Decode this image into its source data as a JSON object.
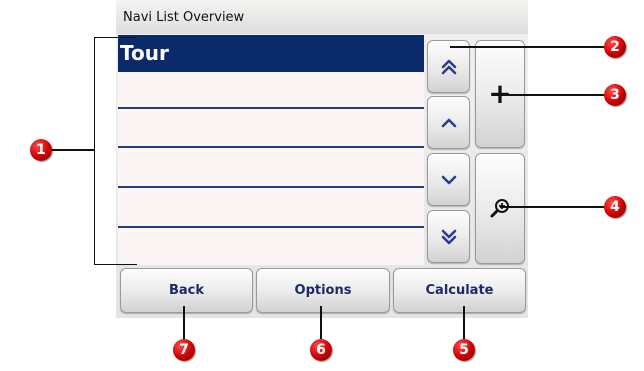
{
  "window": {
    "title": "Navi List Overview"
  },
  "list": {
    "rows": [
      {
        "label": "Tour",
        "selected": true
      },
      {
        "label": "",
        "selected": false
      },
      {
        "label": "",
        "selected": false
      },
      {
        "label": "",
        "selected": false
      },
      {
        "label": "",
        "selected": false
      },
      {
        "label": "",
        "selected": false
      }
    ]
  },
  "scroll_buttons": {
    "page_up_icon": "double-chevron-up-icon",
    "up_icon": "chevron-up-icon",
    "down_icon": "chevron-down-icon",
    "page_down_icon": "double-chevron-down-icon"
  },
  "side_buttons": {
    "add_label": "+",
    "add_icon": "plus-icon",
    "zoom_icon": "magnifier-plus-icon"
  },
  "bottom_buttons": {
    "back_label": "Back",
    "options_label": "Options",
    "calculate_label": "Calculate"
  },
  "callouts": [
    "1",
    "2",
    "3",
    "4",
    "5",
    "6",
    "7"
  ],
  "colors": {
    "selection": "#0b2a6b",
    "row_divider": "#1f3c86",
    "list_background": "#fbf5f5",
    "button_text": "#1a2a6b",
    "marker": "#c80000"
  }
}
